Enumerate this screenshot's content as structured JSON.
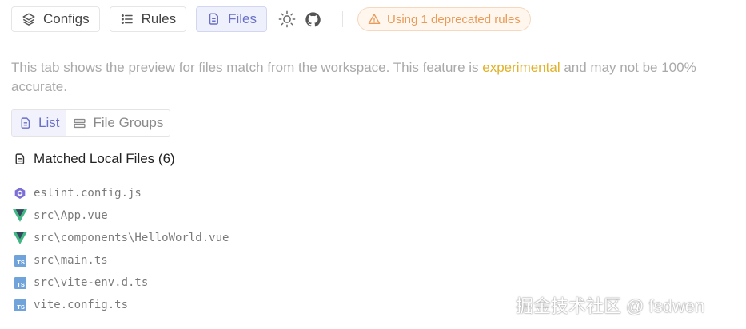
{
  "tabs": [
    {
      "label": "Configs",
      "icon": "layers-icon",
      "active": false
    },
    {
      "label": "Rules",
      "icon": "list-icon",
      "active": false
    },
    {
      "label": "Files",
      "icon": "files-icon",
      "active": true
    }
  ],
  "toolbar": {
    "theme_icon": "sun-icon",
    "repo_icon": "github-icon"
  },
  "warning_badge": {
    "icon": "warning-icon",
    "text": "Using 1 deprecated rules"
  },
  "description": {
    "before": "This tab shows the preview for files match from the workspace. This feature is ",
    "highlight": "experimental",
    "after": " and may not be 100% accurate."
  },
  "view_toggle": {
    "list_label": "List",
    "groups_label": "File Groups",
    "selected": "List"
  },
  "matched": {
    "title": "Matched Local Files (6)",
    "files": [
      {
        "name": "eslint.config.js",
        "icon": "eslint-icon"
      },
      {
        "name": "src\\App.vue",
        "icon": "vue-icon"
      },
      {
        "name": "src\\components\\HelloWorld.vue",
        "icon": "vue-icon"
      },
      {
        "name": "src\\main.ts",
        "icon": "typescript-icon"
      },
      {
        "name": "src\\vite-env.d.ts",
        "icon": "typescript-icon"
      },
      {
        "name": "vite.config.ts",
        "icon": "typescript-icon"
      }
    ]
  },
  "watermark": "掘金技术社区 @ fsdwen",
  "colors": {
    "accent": "#6a70c9",
    "highlight": "#e0b12a",
    "warning": "#e99a57",
    "vue_green": "#41b883",
    "vue_dark": "#35495e",
    "ts_blue": "#3178c6",
    "eslint_purple": "#4b32c3"
  }
}
